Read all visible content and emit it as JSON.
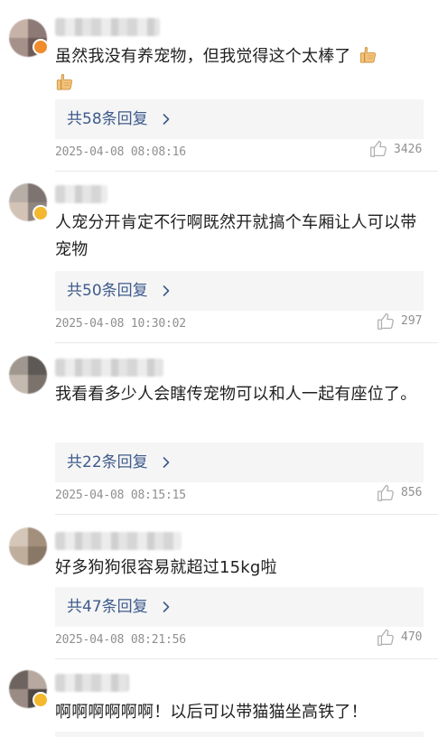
{
  "comments": [
    {
      "text": "虽然我没有养宠物，但我觉得这个太棒了",
      "replies": "共58条回复",
      "time": "2025-04-08 08:08:16",
      "likes": "3426",
      "emoji": [
        "thumbs-up",
        "thumbs-up"
      ]
    },
    {
      "text": "人宠分开肯定不行啊既然开就搞个车厢让人可以带宠物",
      "replies": "共50条回复",
      "time": "2025-04-08 10:30:02",
      "likes": "297"
    },
    {
      "text": "我看看多少人会瞎传宠物可以和人一起有座位了。",
      "replies": "共22条回复",
      "time": "2025-04-08 08:15:15",
      "likes": "856"
    },
    {
      "text": "好多狗狗很容易就超过15kg啦",
      "replies": "共47条回复",
      "time": "2025-04-08 08:21:56",
      "likes": "470"
    },
    {
      "text": "啊啊啊啊啊啊！以后可以带猫猫坐高铁了！"
    }
  ],
  "colors": {
    "reply_link": "#3d5a8c",
    "reply_bg": "#f5f5f5",
    "meta_gray": "#8f8f8f",
    "divider": "#e8e8e8"
  },
  "icons": {
    "like": "thumbs-up-outline-icon",
    "chevron": "chevron-right-icon",
    "emoji": "thumbs-up-emoji"
  }
}
